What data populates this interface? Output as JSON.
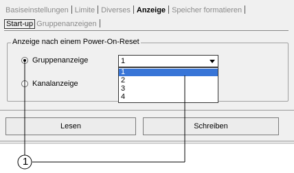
{
  "tabs_top": [
    {
      "label": "Basiseinstellungen",
      "active": false
    },
    {
      "label": "Limite",
      "active": false
    },
    {
      "label": "Diverses",
      "active": false
    },
    {
      "label": "Anzeige",
      "active": true
    },
    {
      "label": "Speicher formatieren",
      "active": false
    }
  ],
  "tabs_sub": [
    {
      "label": "Start-up",
      "active": true
    },
    {
      "label": "Gruppenanzeigen",
      "active": false
    }
  ],
  "group": {
    "legend": "Anzeige nach einem Power-On-Reset",
    "options": [
      {
        "label": "Gruppenanzeige",
        "checked": true
      },
      {
        "label": "Kanalanzeige",
        "checked": false
      }
    ]
  },
  "combo": {
    "value": "1",
    "options": [
      "1",
      "2",
      "3",
      "4"
    ],
    "highlighted_option": "1"
  },
  "buttons": {
    "read": "Lesen",
    "write": "Schreiben"
  },
  "callout": {
    "number": "1"
  },
  "colors": {
    "selection": "#3875d7",
    "background": "#f0f0f0"
  }
}
